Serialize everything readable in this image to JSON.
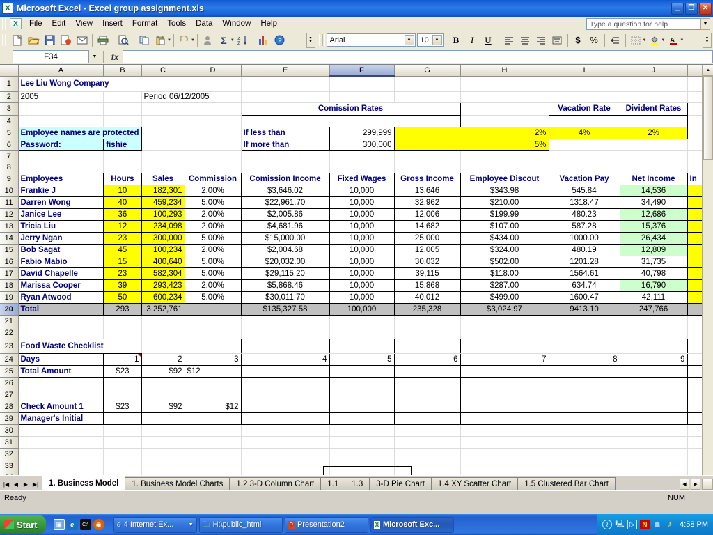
{
  "window": {
    "title": "Microsoft Excel - Excel group assignment.xls",
    "app_icon": "excel-icon",
    "minimize": "_",
    "maximize": "❐",
    "close": "✕"
  },
  "menu": {
    "items": [
      "File",
      "Edit",
      "View",
      "Insert",
      "Format",
      "Tools",
      "Data",
      "Window",
      "Help"
    ],
    "ask_placeholder": "Type a question for help"
  },
  "standard_toolbar": {
    "buttons": [
      {
        "name": "new-icon",
        "glyph": "🗋"
      },
      {
        "name": "open-icon",
        "glyph": "📂"
      },
      {
        "name": "save-icon",
        "glyph": "💾"
      },
      {
        "name": "permission-icon",
        "glyph": "🗐"
      },
      {
        "name": "email-icon",
        "glyph": "✉"
      },
      {
        "name": "print-icon",
        "glyph": "🖨"
      },
      {
        "name": "print-preview-icon",
        "glyph": "🔍"
      },
      {
        "name": "copy-icon",
        "glyph": "⧉"
      },
      {
        "name": "paste-icon",
        "glyph": "📋"
      },
      {
        "name": "undo-icon",
        "glyph": "↩"
      },
      {
        "name": "autosum-person-icon",
        "glyph": "☻"
      },
      {
        "name": "autosum-icon",
        "glyph": "Σ"
      },
      {
        "name": "sort-ascending-icon",
        "glyph": "A↓"
      },
      {
        "name": "chart-wizard-icon",
        "glyph": "📊"
      },
      {
        "name": "help-icon",
        "glyph": "?"
      }
    ]
  },
  "formatting_toolbar": {
    "font_name": "Arial",
    "font_size": "10",
    "bold": "B",
    "italic": "I",
    "underline": "U",
    "align_left": "≡",
    "align_center": "≡",
    "align_right": "≡",
    "merge_center": "⊞",
    "currency": "$",
    "percent": "%",
    "decrease_indent": "⇥",
    "borders": "⊞",
    "fill_color": "▲",
    "font_color": "A"
  },
  "formula_bar": {
    "name_box": "F34",
    "fx_label": "fx",
    "formula_value": ""
  },
  "grid": {
    "columns": [
      "A",
      "B",
      "C",
      "D",
      "E",
      "F",
      "G",
      "H",
      "I",
      "J",
      "K"
    ],
    "selected_column": "F",
    "active_cell": "F34",
    "rows": [
      "1",
      "2",
      "3",
      "4",
      "5",
      "6",
      "7",
      "8",
      "9",
      "10",
      "11",
      "12",
      "13",
      "14",
      "15",
      "16",
      "17",
      "18",
      "19",
      "20",
      "21",
      "22",
      "23",
      "24",
      "25",
      "26",
      "27",
      "28",
      "29",
      "30",
      "31",
      "32",
      "33",
      "34"
    ]
  },
  "sheet": {
    "company_title": "Lee Liu Wong Company",
    "year": "2005",
    "period": "Period 06/12/2005",
    "protection_note": "Employee names are protected",
    "password_label": "Password:",
    "password_value": "fishie",
    "commission_rates": {
      "title": "Comission Rates",
      "rows": [
        {
          "label": "If less than",
          "threshold": "299,999",
          "rate": "2%"
        },
        {
          "label": "If more than",
          "threshold": "300,000",
          "rate": "5%"
        }
      ]
    },
    "rate_table": {
      "vacation_header": "Vacation Rate",
      "dividend_header": "Divident Rates",
      "vacation_value": "4%",
      "dividend_value": "2%"
    },
    "employee_table": {
      "headers": [
        "Employees",
        "Hours",
        "Sales",
        "Commission",
        "Comission Income",
        "Fixed Wages",
        "Gross Income",
        "Employee Discout",
        "Vacation Pay",
        "Net Income",
        "In"
      ],
      "rows": [
        {
          "name": "Frankie J",
          "hours": "10",
          "sales": "182,301",
          "commission": "2.00%",
          "commission_income": "$3,646.02",
          "fixed_wages": "10,000",
          "gross_income": "13,646",
          "employee_discount": "$343.98",
          "vacation_pay": "545.84",
          "net_income": "14,536",
          "net_income_green": true
        },
        {
          "name": "Darren Wong",
          "hours": "40",
          "sales": "459,234",
          "commission": "5.00%",
          "commission_income": "$22,961.70",
          "fixed_wages": "10,000",
          "gross_income": "32,962",
          "employee_discount": "$210.00",
          "vacation_pay": "1318.47",
          "net_income": "34,490",
          "net_income_green": false
        },
        {
          "name": "Janice Lee",
          "hours": "36",
          "sales": "100,293",
          "commission": "2.00%",
          "commission_income": "$2,005.86",
          "fixed_wages": "10,000",
          "gross_income": "12,006",
          "employee_discount": "$199.99",
          "vacation_pay": "480.23",
          "net_income": "12,686",
          "net_income_green": true
        },
        {
          "name": "Tricia Liu",
          "hours": "12",
          "sales": "234,098",
          "commission": "2.00%",
          "commission_income": "$4,681.96",
          "fixed_wages": "10,000",
          "gross_income": "14,682",
          "employee_discount": "$107.00",
          "vacation_pay": "587.28",
          "net_income": "15,376",
          "net_income_green": true
        },
        {
          "name": "Jerry Ngan",
          "hours": "23",
          "sales": "300,000",
          "commission": "5.00%",
          "commission_income": "$15,000.00",
          "fixed_wages": "10,000",
          "gross_income": "25,000",
          "employee_discount": "$434.00",
          "vacation_pay": "1000.00",
          "net_income": "26,434",
          "net_income_green": true
        },
        {
          "name": "Bob Sagat",
          "hours": "45",
          "sales": "100,234",
          "commission": "2.00%",
          "commission_income": "$2,004.68",
          "fixed_wages": "10,000",
          "gross_income": "12,005",
          "employee_discount": "$324.00",
          "vacation_pay": "480.19",
          "net_income": "12,809",
          "net_income_green": true
        },
        {
          "name": "Fabio Mabio",
          "hours": "15",
          "sales": "400,640",
          "commission": "5.00%",
          "commission_income": "$20,032.00",
          "fixed_wages": "10,000",
          "gross_income": "30,032",
          "employee_discount": "$502.00",
          "vacation_pay": "1201.28",
          "net_income": "31,735",
          "net_income_green": false
        },
        {
          "name": "David Chapelle",
          "hours": "23",
          "sales": "582,304",
          "commission": "5.00%",
          "commission_income": "$29,115.20",
          "fixed_wages": "10,000",
          "gross_income": "39,115",
          "employee_discount": "$118.00",
          "vacation_pay": "1564.61",
          "net_income": "40,798",
          "net_income_green": false
        },
        {
          "name": "Marissa Cooper",
          "hours": "39",
          "sales": "293,423",
          "commission": "2.00%",
          "commission_income": "$5,868.46",
          "fixed_wages": "10,000",
          "gross_income": "15,868",
          "employee_discount": "$287.00",
          "vacation_pay": "634.74",
          "net_income": "16,790",
          "net_income_green": true
        },
        {
          "name": "Ryan Atwood",
          "hours": "50",
          "sales": "600,234",
          "commission": "5.00%",
          "commission_income": "$30,011.70",
          "fixed_wages": "10,000",
          "gross_income": "40,012",
          "employee_discount": "$499.00",
          "vacation_pay": "1600.47",
          "net_income": "42,111",
          "net_income_green": false
        }
      ],
      "total_row": {
        "label": "Total",
        "hours": "293",
        "sales": "3,252,761",
        "commission": "",
        "commission_income": "$135,327.58",
        "fixed_wages": "100,000",
        "gross_income": "235,328",
        "employee_discount": "$3,024.97",
        "vacation_pay": "9413.10",
        "net_income": "247,766"
      }
    },
    "food_waste": {
      "title": "Food Waste Checklist",
      "days_label": "Days",
      "days": [
        "1",
        "2",
        "3",
        "4",
        "5",
        "6",
        "7",
        "8",
        "9"
      ],
      "total_amount_label": "Total Amount",
      "total_amounts": [
        "$23",
        "$92",
        "$12",
        "",
        "",
        "",
        "",
        "",
        ""
      ],
      "check_amount_label": "Check Amount 1",
      "check_amounts": [
        "$23",
        "$92",
        "$12",
        "",
        "",
        "",
        "",
        "",
        ""
      ],
      "manager_initial_label": "Manager's Initial",
      "manager_initials": [
        "",
        "",
        "",
        "",
        "",
        "",
        "",
        "",
        ""
      ]
    }
  },
  "sheet_tabs": {
    "nav": [
      "|◀",
      "◀",
      "▶",
      "▶|"
    ],
    "tabs": [
      {
        "label": "1. Business Model",
        "active": true
      },
      {
        "label": "1. Business Model Charts",
        "active": false
      },
      {
        "label": "1.2 3-D Column Chart",
        "active": false
      },
      {
        "label": "1.1",
        "active": false
      },
      {
        "label": "1.3",
        "active": false
      },
      {
        "label": "3-D Pie Chart",
        "active": false
      },
      {
        "label": "1.4 XY Scatter Chart",
        "active": false
      },
      {
        "label": "1.5 Clustered Bar Chart",
        "active": false
      }
    ]
  },
  "status_bar": {
    "message": "Ready",
    "mode": "NUM"
  },
  "taskbar": {
    "start_label": "Start",
    "quick_launch": [
      {
        "name": "show-desktop-icon",
        "glyph": "▣",
        "color": "#4a8fd4"
      },
      {
        "name": "internet-explorer-icon",
        "glyph": "e",
        "color": "#1a6fc4"
      },
      {
        "name": "console-icon",
        "glyph": "C:\\",
        "color": "#10100f"
      },
      {
        "name": "firefox-icon",
        "glyph": "◉",
        "color": "#e66000"
      }
    ],
    "items": [
      {
        "name": "taskbar-internet-explorer",
        "label": "4 Internet Ex...",
        "icon": "internet-explorer-icon",
        "active": false,
        "has_arrow": true
      },
      {
        "name": "taskbar-explorer-window",
        "label": "H:\\public_html",
        "icon": "folder-icon",
        "active": false,
        "has_arrow": false
      },
      {
        "name": "taskbar-powerpoint",
        "label": "Presentation2",
        "icon": "powerpoint-icon",
        "active": false,
        "has_arrow": false
      },
      {
        "name": "taskbar-excel",
        "label": "Microsoft Exc...",
        "icon": "excel-icon",
        "active": true,
        "has_arrow": false
      }
    ],
    "tray_icons": [
      {
        "name": "volume-icon",
        "glyph": "🕪"
      },
      {
        "name": "network-icon",
        "glyph": "🖧"
      },
      {
        "name": "media-icon",
        "glyph": "▷"
      },
      {
        "name": "norton-icon",
        "glyph": "N"
      },
      {
        "name": "messenger-icon",
        "glyph": "☗"
      },
      {
        "name": "key-icon",
        "glyph": "⚷"
      }
    ],
    "clock": "4:58 PM"
  },
  "colors": {
    "accent": "#000080",
    "highlight_yellow": "#ffff00",
    "highlight_green": "#ccffcc",
    "highlight_cyan": "#ccffff",
    "total_gray": "#c0c0c0",
    "titlebar_blue": "#2a7ae8"
  }
}
